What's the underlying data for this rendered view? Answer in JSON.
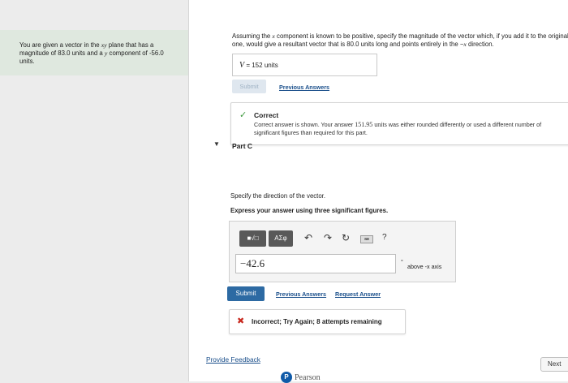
{
  "problem": {
    "statement_parts": [
      "You are given a vector in the ",
      "xy",
      " plane that has a magnitude of 83.0 units and a ",
      "y",
      " component of -56.0 units."
    ]
  },
  "part_b": {
    "prompt_parts": [
      "Assuming the ",
      "x",
      " component is known to be positive, specify the magnitude of the vector which, if you add it to the original one, would give a resultant vector that is 80.0 units long and points entirely in the −",
      "x",
      " direction."
    ],
    "answer_var": "V",
    "answer_eq": " = ",
    "answer_value": "152",
    "answer_units": "units",
    "submit_label": "Submit",
    "previous_answers_label": "Previous Answers",
    "feedback": {
      "icon": "✓",
      "title": "Correct",
      "message_start": "Correct answer is shown. Your answer ",
      "message_value": "151.95 units",
      "message_end": " was either rounded differently or used a different number of significant figures than required for this part."
    }
  },
  "part_c": {
    "arrow": "▼",
    "title": "Part C",
    "specify": "Specify the direction of the vector.",
    "express": "Express your answer using three significant figures.",
    "toolbar": {
      "template_label": "■√□",
      "greek_label": "ΑΣφ",
      "undo": "↶",
      "redo": "↷",
      "reset": "↻",
      "keyboard": "⌨",
      "help": "?"
    },
    "input_value": "−42.6",
    "unit_degree": "°",
    "unit_label": "above -x axis",
    "submit_label": "Submit",
    "previous_answers_label": "Previous Answers",
    "request_answer_label": "Request Answer",
    "feedback": {
      "icon": "✖",
      "text": "Incorrect; Try Again; 8 attempts remaining"
    }
  },
  "footer": {
    "provide_feedback": "Provide Feedback",
    "next_label": "Next",
    "brand_mark": "P",
    "brand": "Pearson"
  },
  "colors": {
    "accent": "#2d6aa3",
    "link": "#1a4f8b",
    "correct": "#3f9a3f",
    "incorrect": "#c8281e",
    "left_panel_bg": "#dfe8df"
  }
}
